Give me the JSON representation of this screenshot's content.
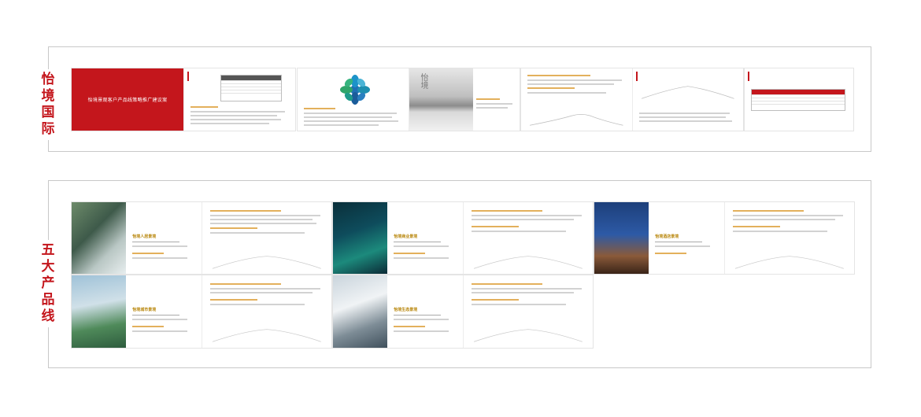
{
  "sections": [
    {
      "label": "怡境国际"
    },
    {
      "label": "五大产品线"
    }
  ],
  "cover": {
    "title": "怡境景观客户产品线策略推广建议案"
  },
  "brand_glyph": "怡境",
  "product_lines": [
    {
      "name": "怡境人居景境"
    },
    {
      "name": "怡境商业景境"
    },
    {
      "name": "怡境酒店景境"
    },
    {
      "name": "怡境城市景境"
    },
    {
      "name": "怡境生态景境"
    }
  ],
  "colors": {
    "brand_red": "#c4161c",
    "gold": "#b8860b",
    "frame": "#c8c8c8"
  }
}
